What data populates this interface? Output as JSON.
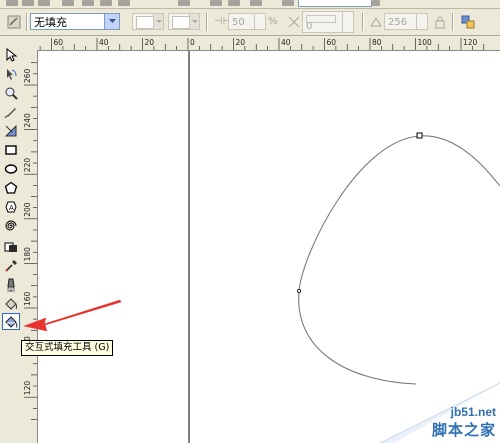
{
  "property_bar": {
    "fill_type": "无填充",
    "midpoint_value": "50",
    "midpoint_unit": "%",
    "edge_pad_value": "0",
    "steps_value": "256"
  },
  "ruler_h": {
    "labels": [
      "60",
      "40",
      "20",
      "0",
      "20",
      "40",
      "60",
      "80",
      "100",
      "120"
    ]
  },
  "ruler_v": {
    "labels": [
      "260",
      "240",
      "220",
      "200",
      "180",
      "160",
      "140",
      "120"
    ]
  },
  "tooltip": {
    "text": "交互式填充工具 (G)"
  },
  "watermark": {
    "site": "jb51.net",
    "name": "脚本之家"
  },
  "colors": {
    "accent": "#316ac5",
    "arrow": "#e8332f",
    "curve": "#7a7a7a",
    "guide": "#000000"
  },
  "icons": {
    "tools": [
      "pick-tool-icon",
      "shape-tool-icon",
      "zoom-tool-icon",
      "freehand-tool-icon",
      "smart-fill-icon",
      "rectangle-tool-icon",
      "ellipse-tool-icon",
      "polygon-tool-icon",
      "text-tool-icon",
      "spiral-tool-icon",
      "interactive-blend-icon",
      "eyedropper-icon",
      "outline-pen-icon",
      "fill-bucket-icon",
      "interactive-fill-icon"
    ]
  }
}
